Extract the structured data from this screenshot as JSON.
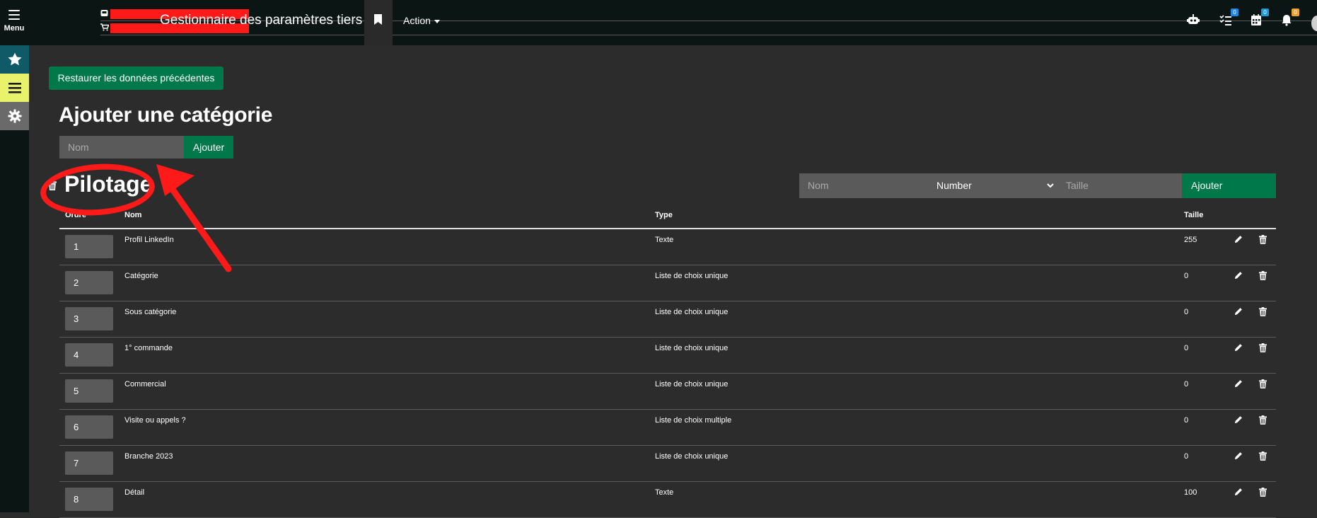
{
  "header": {
    "menu_label": "Menu",
    "title": "Gestionnaire des paramètres tiers",
    "action_label": "Action",
    "badges": {
      "tasks": "0",
      "calendar": "0",
      "notifications": "0"
    },
    "badge_colors": {
      "tasks": "#1e88e5",
      "calendar": "#1e9bd7",
      "notifications": "#f0a030"
    }
  },
  "sidebar": {
    "items": [
      {
        "icon": "star-icon",
        "color": "#0f5a66"
      },
      {
        "icon": "hamburger-icon",
        "color": "#e8f26a"
      },
      {
        "icon": "gear-icon",
        "color": "#6a6a6a"
      }
    ]
  },
  "toolbar": {
    "restore_label": "Restaurer les données précédentes"
  },
  "add_category": {
    "title": "Ajouter une catégorie",
    "input_placeholder": "Nom",
    "button_label": "Ajouter"
  },
  "category": {
    "name": "Pilotage",
    "field_form": {
      "name_placeholder": "Nom",
      "type_selected": "Number",
      "size_placeholder": "Taille",
      "button_label": "Ajouter"
    },
    "columns": {
      "order": "Ordre",
      "name": "Nom",
      "type": "Type",
      "size": "Taille"
    },
    "rows": [
      {
        "order": "1",
        "name": "Profil LinkedIn",
        "type": "Texte",
        "size": "255"
      },
      {
        "order": "2",
        "name": "Catégorie",
        "type": "Liste de choix unique",
        "size": "0"
      },
      {
        "order": "3",
        "name": "Sous catégorie",
        "type": "Liste de choix unique",
        "size": "0"
      },
      {
        "order": "4",
        "name": "1° commande",
        "type": "Liste de choix unique",
        "size": "0"
      },
      {
        "order": "5",
        "name": "Commercial",
        "type": "Liste de choix unique",
        "size": "0"
      },
      {
        "order": "6",
        "name": "Visite ou appels ?",
        "type": "Liste de choix multiple",
        "size": "0"
      },
      {
        "order": "7",
        "name": "Branche 2023",
        "type": "Liste de choix unique",
        "size": "0"
      },
      {
        "order": "8",
        "name": "Détail",
        "type": "Texte",
        "size": "100"
      }
    ]
  },
  "colors": {
    "accent_green": "#00784a",
    "annotation_red": "#ff1a1a",
    "background": "#2c2c2c",
    "topbar": "#0b1514"
  }
}
